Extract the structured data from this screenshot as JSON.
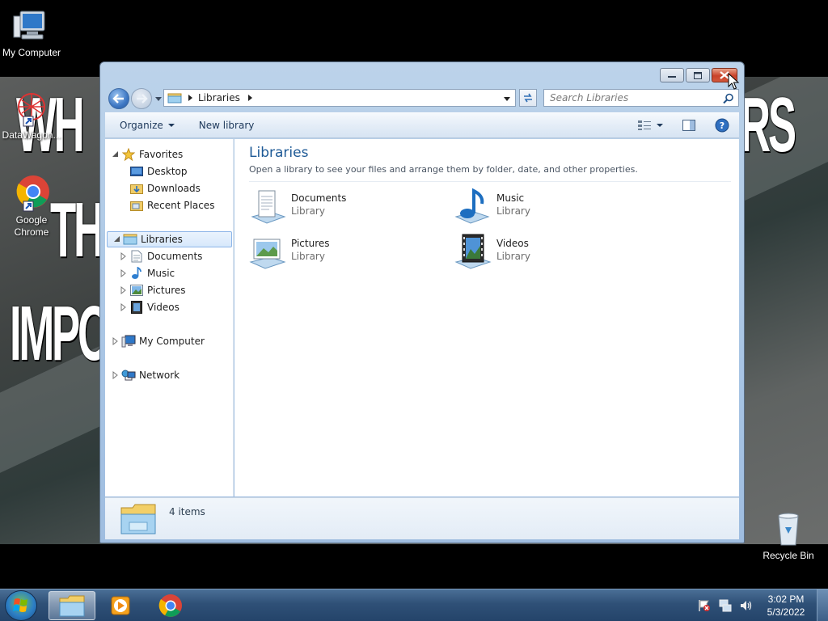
{
  "desktop": {
    "wallpaper_words": [
      "WH",
      "RS",
      "TH",
      "IMPOS"
    ],
    "icons": [
      {
        "label": "My Computer"
      },
      {
        "label": "DataWagon..."
      },
      {
        "label": "Google Chrome"
      },
      {
        "label": "Recycle Bin"
      }
    ]
  },
  "window": {
    "address": {
      "crumb": "Libraries"
    },
    "search": {
      "placeholder": "Search Libraries"
    },
    "commands": {
      "organize": "Organize",
      "new_library": "New library"
    },
    "nav": {
      "favorites": "Favorites",
      "favorites_items": [
        "Desktop",
        "Downloads",
        "Recent Places"
      ],
      "libraries": "Libraries",
      "libraries_items": [
        "Documents",
        "Music",
        "Pictures",
        "Videos"
      ],
      "computer": "My Computer",
      "network": "Network"
    },
    "content": {
      "title": "Libraries",
      "description": "Open a library to see your files and arrange them by folder, date, and other properties.",
      "libraries": [
        {
          "name": "Documents",
          "type": "Library",
          "icon": "documents-library-icon"
        },
        {
          "name": "Music",
          "type": "Library",
          "icon": "music-library-icon"
        },
        {
          "name": "Pictures",
          "type": "Library",
          "icon": "pictures-library-icon"
        },
        {
          "name": "Videos",
          "type": "Library",
          "icon": "videos-library-icon"
        }
      ]
    },
    "details": {
      "count": "4 items"
    }
  },
  "taskbar": {
    "clock": {
      "time": "3:02 PM",
      "date": "5/3/2022"
    }
  },
  "colors": {
    "title_blue": "#1e5a96",
    "selection": "#d7e8fb",
    "taskbar": "#2f5077"
  }
}
